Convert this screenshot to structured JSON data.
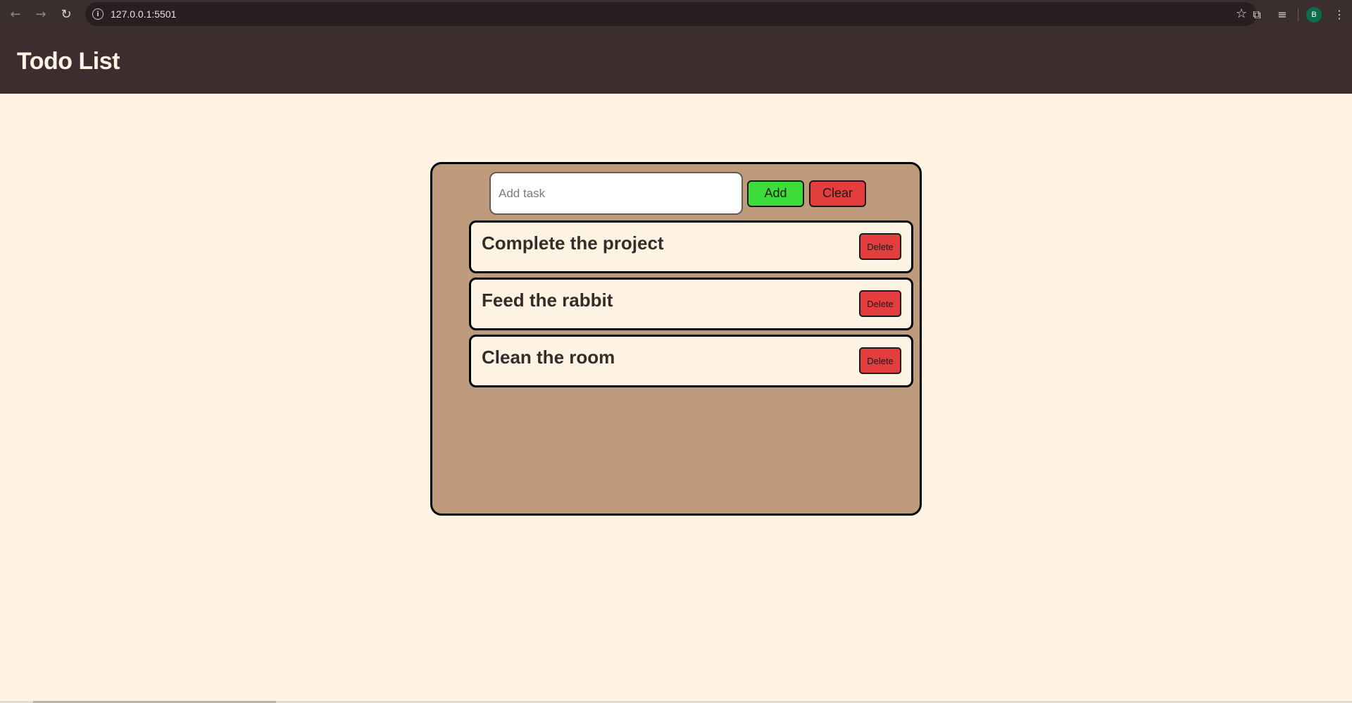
{
  "browser": {
    "url": "127.0.0.1:5501",
    "info_glyph": "i",
    "back_glyph": "←",
    "forward_glyph": "→",
    "reload_glyph": "↻",
    "star_glyph": "☆",
    "extensions_glyph": "⧉",
    "media_glyph": "≡",
    "menu_glyph": "⋮",
    "avatar_letter": "B",
    "avatar_color": "#0f6b4d"
  },
  "app": {
    "title": "Todo List"
  },
  "input": {
    "placeholder": "Add task",
    "value": ""
  },
  "buttons": {
    "add_label": "Add",
    "clear_label": "Clear",
    "delete_label": "Delete"
  },
  "tasks": [
    {
      "text": "Complete the project"
    },
    {
      "text": "Feed the rabbit"
    },
    {
      "text": "Clean the room"
    }
  ],
  "colors": {
    "header_bg": "#3d2d2e",
    "page_bg": "#fff3e4",
    "panel_bg": "#bd9b7c",
    "add_green": "#3ddc3b",
    "danger_red": "#e33d3d"
  }
}
